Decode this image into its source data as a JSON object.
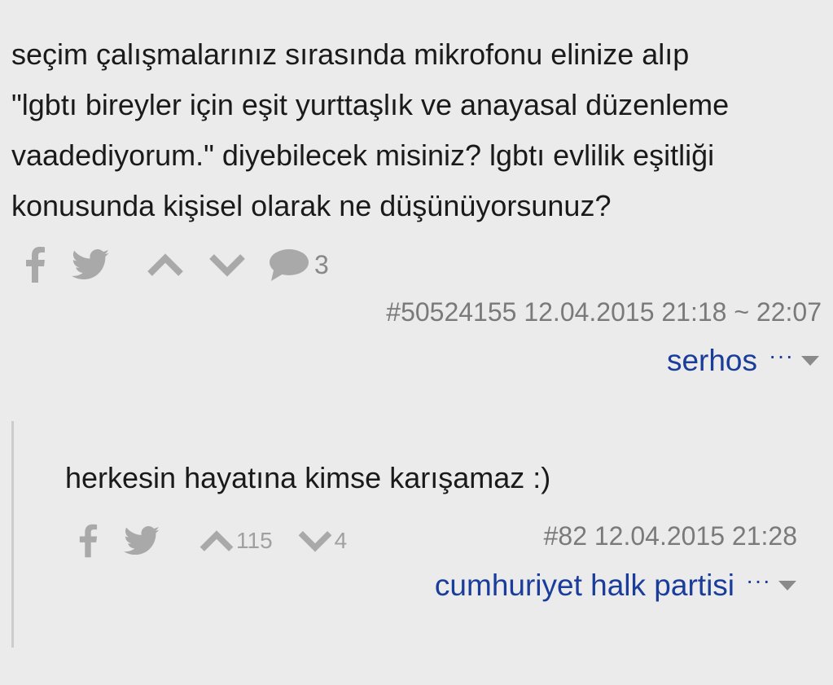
{
  "entry": {
    "lines": [
      "seçim çalışmalarınız sırasında mikrofonu elinize alıp",
      "\"lgbtı bireyler için eşit yurttaşlık ve anayasal düzenleme",
      "vaadediyorum.\" diyebilecek misiniz? lgbtı evlilik eşitliği",
      "konusunda kişisel olarak ne düşünüyorsunuz?"
    ],
    "comment_count": "3",
    "meta": "#50524155 12.04.2015 21:18 ~ 22:07",
    "author": "serhos",
    "more_label": "···"
  },
  "reply": {
    "text": "herkesin hayatına kimse karışamaz :)",
    "upvotes": "115",
    "downvotes": "4",
    "meta": "#82 12.04.2015 21:28",
    "author": "cumhuriyet halk partisi",
    "more_label": "···"
  },
  "icons": {
    "facebook": "facebook-icon",
    "twitter": "twitter-icon",
    "upvote": "chevron-up-icon",
    "downvote": "chevron-down-icon",
    "comment": "comment-icon",
    "caret": "caret-down-icon"
  },
  "colors": {
    "background": "#ebebeb",
    "text": "#1a1a1a",
    "author_link": "#1a3c9b",
    "icon": "#a9a9a9",
    "meta": "#7a7a7a"
  }
}
